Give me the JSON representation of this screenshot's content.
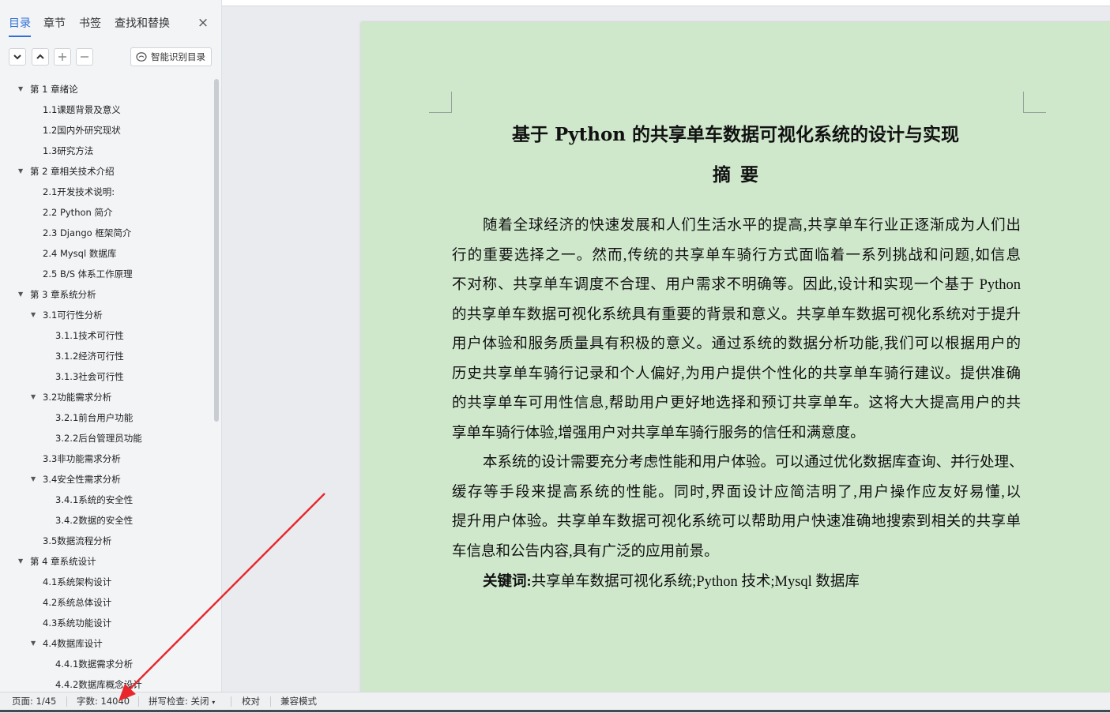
{
  "sidebar": {
    "tabs": [
      {
        "label": "目录",
        "active": true
      },
      {
        "label": "章节",
        "active": false
      },
      {
        "label": "书签",
        "active": false
      },
      {
        "label": "查找和替换",
        "active": false
      }
    ],
    "close_symbol": "×",
    "smart_button_label": "智能识别目录",
    "toc": [
      {
        "label": "第 1 章绪论",
        "level": 0,
        "expanded": true
      },
      {
        "label": "1.1课题背景及意义",
        "level": 1
      },
      {
        "label": "1.2国内外研究现状",
        "level": 1
      },
      {
        "label": "1.3研究方法",
        "level": 1
      },
      {
        "label": "第 2 章相关技术介绍",
        "level": 0,
        "expanded": true
      },
      {
        "label": "2.1开发技术说明:",
        "level": 1
      },
      {
        "label": "2.2  Python 简介",
        "level": 1
      },
      {
        "label": "2.3  Django 框架简介",
        "level": 1
      },
      {
        "label": "2.4  Mysql 数据库",
        "level": 1
      },
      {
        "label": "2.5  B/S 体系工作原理",
        "level": 1
      },
      {
        "label": "第 3 章系统分析",
        "level": 0,
        "expanded": true
      },
      {
        "label": "3.1可行性分析",
        "level": 1,
        "expanded": true
      },
      {
        "label": "3.1.1技术可行性",
        "level": 2
      },
      {
        "label": "3.1.2经济可行性",
        "level": 2
      },
      {
        "label": "3.1.3社会可行性",
        "level": 2
      },
      {
        "label": "3.2功能需求分析",
        "level": 1,
        "expanded": true
      },
      {
        "label": "3.2.1前台用户功能",
        "level": 2
      },
      {
        "label": "3.2.2后台管理员功能",
        "level": 2
      },
      {
        "label": "3.3非功能需求分析",
        "level": 1
      },
      {
        "label": "3.4安全性需求分析",
        "level": 1,
        "expanded": true
      },
      {
        "label": "3.4.1系统的安全性",
        "level": 2
      },
      {
        "label": "3.4.2数据的安全性",
        "level": 2
      },
      {
        "label": "3.5数据流程分析",
        "level": 1
      },
      {
        "label": "第 4 章系统设计",
        "level": 0,
        "expanded": true
      },
      {
        "label": "4.1系统架构设计",
        "level": 1
      },
      {
        "label": "4.2系统总体设计",
        "level": 1
      },
      {
        "label": "4.3系统功能设计",
        "level": 1
      },
      {
        "label": "4.4数据库设计",
        "level": 1,
        "expanded": true
      },
      {
        "label": "4.4.1数据需求分析",
        "level": 2
      },
      {
        "label": "4.4.2数据库概念设计",
        "level": 2
      }
    ]
  },
  "document": {
    "title": "基于 Python 的共享单车数据可视化系统的设计与实现",
    "subtitle": "摘要",
    "paragraph1_lines": [
      "随着全球经济的快速发展和人们生活水平的提高,共享单车行业正逐渐成为人们出",
      "行的重要选择之一。然而,传统的共享单车骑行方式面临着一系列挑战和问题,如信息",
      "不对称、共享单车调度不合理、用户需求不明确等。因此,设计和实现一个基于 Python",
      "的共享单车数据可视化系统具有重要的背景和意义。共享单车数据可视化系统对于提升",
      "用户体验和服务质量具有积极的意义。通过系统的数据分析功能,我们可以根据用户的",
      "历史共享单车骑行记录和个人偏好,为用户提供个性化的共享单车骑行建议。提供准确",
      "的共享单车可用性信息,帮助用户更好地选择和预订共享单车。这将大大提高用户的共",
      "享单车骑行体验,增强用户对共享单车骑行服务的信任和满意度。"
    ],
    "paragraph2_lines": [
      "本系统的设计需要充分考虑性能和用户体验。可以通过优化数据库查询、并行处理、",
      "缓存等手段来提高系统的性能。同时,界面设计应简洁明了,用户操作应友好易懂,以",
      "提升用户体验。共享单车数据可视化系统可以帮助用户快速准确地搜索到相关的共享单",
      "车信息和公告内容,具有广泛的应用前景。"
    ],
    "keywords_label": "关键词:",
    "keywords_text": "共享单车数据可视化系统;Python 技术;Mysql 数据库"
  },
  "statusbar": {
    "page": "页面: 1/45",
    "word_count": "字数: 14040",
    "spell_check": "拼写检查: 关闭",
    "proofread": "校对",
    "compat_mode": "兼容模式"
  },
  "colors": {
    "page_background": "#cfe8cc",
    "accent": "#2f6fd7",
    "annotation_arrow": "#e8262c"
  }
}
